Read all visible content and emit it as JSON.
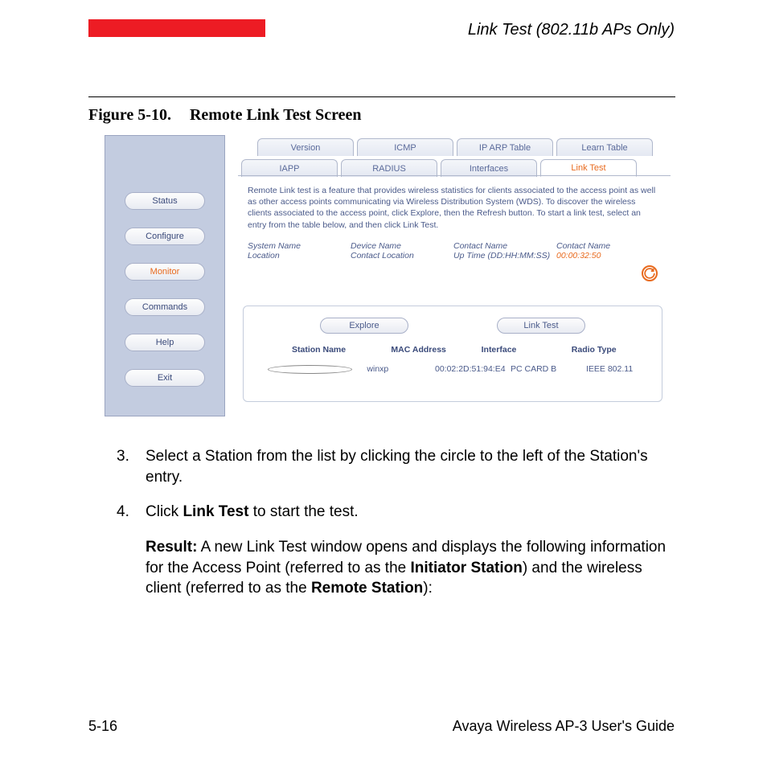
{
  "header": {
    "section_title": "Link Test (802.11b APs Only)"
  },
  "figure": {
    "label": "Figure 5-10.",
    "title": "Remote Link Test Screen"
  },
  "screenshot": {
    "sidebar": {
      "items": [
        {
          "label": "Status",
          "active": false
        },
        {
          "label": "Configure",
          "active": false
        },
        {
          "label": "Monitor",
          "active": true
        },
        {
          "label": "Commands",
          "active": false
        },
        {
          "label": "Help",
          "active": false
        },
        {
          "label": "Exit",
          "active": false
        }
      ]
    },
    "tabs_top": [
      {
        "label": "Version"
      },
      {
        "label": "ICMP"
      },
      {
        "label": "IP ARP Table"
      },
      {
        "label": "Learn Table"
      }
    ],
    "tabs_bottom": [
      {
        "label": "IAPP"
      },
      {
        "label": "RADIUS"
      },
      {
        "label": "Interfaces"
      },
      {
        "label": "Link Test",
        "active": true
      }
    ],
    "description": "Remote Link test is a feature that provides wireless statistics for clients associated to the access point as well as other access points communicating via Wireless Distribution System (WDS). To discover the wireless clients associated to the access point, click Explore, then the Refresh button. To start a link test, select an entry from the table below, and then click Link Test.",
    "info": {
      "col1": {
        "line1": "System Name",
        "line2": "Location"
      },
      "col2": {
        "line1": "Device Name",
        "line2": "Contact Location"
      },
      "col3": {
        "line1": "Contact Name",
        "line2": "Up Time (DD:HH:MM:SS)"
      },
      "col4": {
        "line1": "Contact Name",
        "line2": "00:00:32:50"
      }
    },
    "panel": {
      "explore_btn": "Explore",
      "linktest_btn": "Link Test",
      "headers": {
        "c1": "Station Name",
        "c2": "MAC Address",
        "c3": "Interface",
        "c4": "Radio Type"
      },
      "row": {
        "c1": "winxp",
        "c2": "00:02:2D:51:94:E4",
        "c3": "PC CARD B",
        "c4": "IEEE 802.11"
      }
    }
  },
  "body": {
    "step3_num": "3.",
    "step3": "Select a Station from the list by clicking the circle to the left of the Station's entry.",
    "step4_num": "4.",
    "step4_pre": "Click ",
    "step4_bold": "Link Test",
    "step4_post": " to start the test.",
    "result_label": "Result:",
    "result_t1": " A new Link Test window opens and displays the following information for the Access Point (referred to as the ",
    "result_b1": "Initiator Station",
    "result_t2": ") and the wireless client (referred to as the ",
    "result_b2": "Remote Station",
    "result_t3": "):"
  },
  "footer": {
    "page": "5-16",
    "doc": "Avaya Wireless AP-3 User's Guide"
  }
}
